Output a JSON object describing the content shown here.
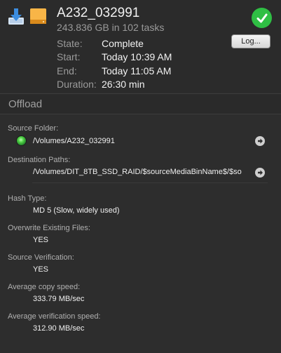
{
  "header": {
    "title": "A232_032991",
    "subtitle": "243.836 GB in 102 tasks",
    "log_button": "Log...",
    "info": {
      "state_label": "State:",
      "state_value": "Complete",
      "start_label": "Start:",
      "start_value": "Today 10:39 AM",
      "end_label": "End:",
      "end_value": "Today 11:05 AM",
      "duration_label": "Duration:",
      "duration_value": "26:30 min"
    }
  },
  "section": {
    "title": "Offload"
  },
  "fields": {
    "source_folder_label": "Source Folder:",
    "source_folder_value": "/Volumes/A232_032991",
    "destination_paths_label": "Destination Paths:",
    "destination_path_value": "/Volumes/DIT_8TB_SSD_RAID/$sourceMediaBinName$/$so",
    "hash_type_label": "Hash Type:",
    "hash_type_value": "MD 5 (Slow, widely used)",
    "overwrite_label": "Overwrite Existing Files:",
    "overwrite_value": "YES",
    "source_verification_label": "Source Verification:",
    "source_verification_value": "YES",
    "avg_copy_label": "Average copy speed:",
    "avg_copy_value": "333.79 MB/sec",
    "avg_verify_label": "Average verification speed:",
    "avg_verify_value": "312.90 MB/sec"
  },
  "icons": {
    "download": "download-icon",
    "drive": "hard-drive-icon",
    "complete": "checkmark-icon",
    "reveal": "arrow-right-icon",
    "status_dot": "status-light-icon"
  },
  "colors": {
    "background": "#2d2d2d",
    "success": "#2fbf44",
    "drive": "#f5a623",
    "download": "#4a90d9"
  }
}
